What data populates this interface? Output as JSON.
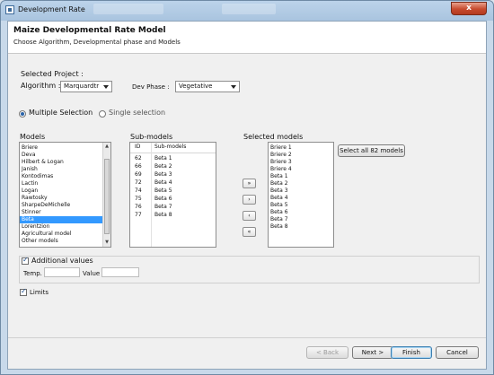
{
  "window": {
    "title": "Development Rate",
    "close_label": "x"
  },
  "header": {
    "title": "Maize Developmental Rate Model",
    "subtitle": "Choose Algorithm, Developmental phase and Models"
  },
  "project": {
    "label": "Selected Project :",
    "algorithm_label": "Algorithm :",
    "algorithm_value": "Marquardtr",
    "phase_label": "Dev Phase :",
    "phase_value": "Vegetative"
  },
  "selection_mode": {
    "multiple_label": "Multiple Selection",
    "single_label": "Single selection",
    "selected": "multiple"
  },
  "models": {
    "label": "Models",
    "items": [
      "Briere",
      "Deva",
      "Hilbert & Logan",
      "Janish",
      "Kontodimas",
      "Lactin",
      "Logan",
      "Rawtosky",
      "SharpeDeMichelle",
      "Stinner",
      "Beta",
      "Lorentzion",
      "Agricultural model",
      "Other models"
    ],
    "selected_index": 10
  },
  "submodels": {
    "label": "Sub-models",
    "columns": [
      "ID",
      "Sub-models"
    ],
    "rows": [
      {
        "id": "62",
        "name": "Beta 1"
      },
      {
        "id": "66",
        "name": "Beta 2"
      },
      {
        "id": "69",
        "name": "Beta 3"
      },
      {
        "id": "72",
        "name": "Beta 4"
      },
      {
        "id": "74",
        "name": "Beta 5"
      },
      {
        "id": "75",
        "name": "Beta 6"
      },
      {
        "id": "76",
        "name": "Beta 7"
      },
      {
        "id": "77",
        "name": "Beta 8"
      }
    ]
  },
  "transfer": {
    "add_all": "»",
    "add": "›",
    "remove": "‹",
    "remove_all": "«"
  },
  "selected_models": {
    "label": "Selected models",
    "items": [
      "Briere 1",
      "Briere 2",
      "Briere 3",
      "Briere 4",
      "Beta 1",
      "Beta 2",
      "Beta 3",
      "Beta 4",
      "Beta 5",
      "Beta 6",
      "Beta 7",
      "Beta 8"
    ],
    "select_all_label": "Select all 82 models"
  },
  "additional": {
    "label": "Additional values",
    "checked": true,
    "temp_label": "Temp.",
    "value_label": "Value",
    "temp_value": "",
    "value_value": ""
  },
  "limits": {
    "label": "Limits",
    "checked": true
  },
  "footer": {
    "back": "< Back",
    "next": "Next >",
    "finish": "Finish",
    "cancel": "Cancel"
  }
}
